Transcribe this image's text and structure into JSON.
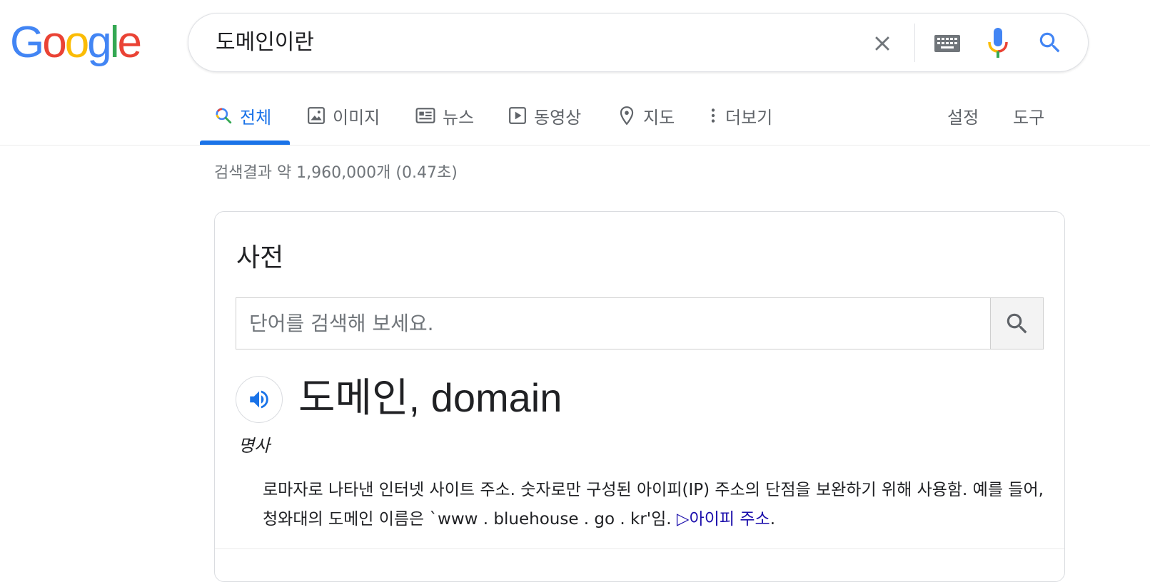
{
  "logo": {
    "letters": [
      {
        "char": "G",
        "color": "#4285F4"
      },
      {
        "char": "o",
        "color": "#EA4335"
      },
      {
        "char": "o",
        "color": "#FBBC05"
      },
      {
        "char": "g",
        "color": "#4285F4"
      },
      {
        "char": "l",
        "color": "#34A853"
      },
      {
        "char": "e",
        "color": "#EA4335"
      }
    ]
  },
  "search": {
    "query": "도메인이란",
    "icons": [
      "close-icon",
      "keyboard-icon",
      "microphone-icon",
      "search-icon"
    ]
  },
  "tabs": {
    "all": "전체",
    "images": "이미지",
    "news": "뉴스",
    "videos": "동영상",
    "maps": "지도",
    "more": "더보기",
    "settings": "설정",
    "tools": "도구",
    "active": "all",
    "accent_color": "#1a73e8"
  },
  "result_stats": "검색결과 약 1,960,000개 (0.47초)",
  "dictionary": {
    "title": "사전",
    "input_placeholder": "단어를 검색해 보세요.",
    "headword": "도메인, domain",
    "part_of_speech": "명사",
    "definition_text": "로마자로 나타낸 인터넷 사이트 주소. 숫자로만 구성된 아이피(IP) 주소의 단점을 보완하기 위해 사용함. 예를 들어, 청와대의 도메인 이름은 `www . bluehouse . go . kr'임. ",
    "see_also_arrow": "▷",
    "see_also_link": "아이피 주소",
    "see_also_suffix": "."
  }
}
